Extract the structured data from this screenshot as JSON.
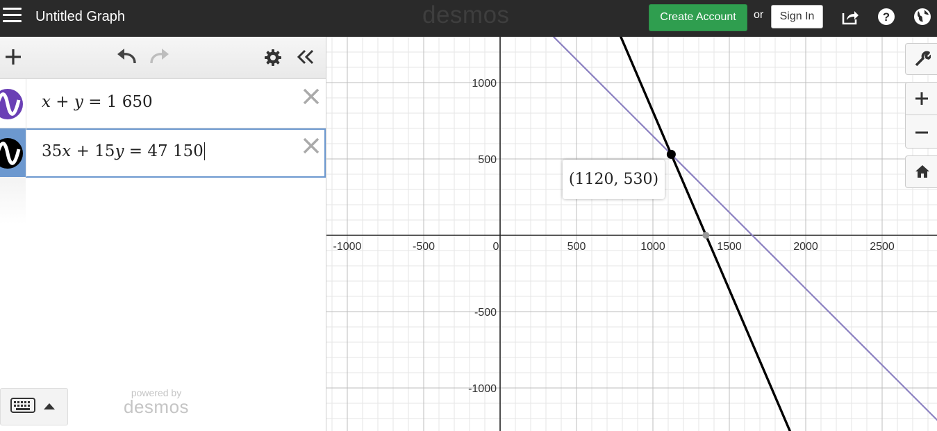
{
  "topbar": {
    "title": "Untitled Graph",
    "logo": "desmos",
    "create_account": "Create Account",
    "or": "or",
    "sign_in": "Sign In"
  },
  "expressions": [
    {
      "index": 1,
      "color": "#6a3fb5",
      "tokens": [
        "x",
        " + ",
        "y",
        " = 1 650"
      ]
    },
    {
      "index": 2,
      "color": "#000000",
      "tokens": [
        "35",
        "x",
        " + 15",
        "y",
        " = 47 150"
      ]
    }
  ],
  "footer": {
    "powered_by": "powered by",
    "brand": "desmos"
  },
  "graph": {
    "x_ticks": [
      "-1000",
      "-500",
      "0",
      "500",
      "1000",
      "1500",
      "2000",
      "2500"
    ],
    "y_ticks": [
      "1000",
      "500",
      "-500",
      "-1000"
    ],
    "intersection_label": "(1120, 530)",
    "intersection": [
      1120,
      530
    ],
    "x_intercept_line2": [
      1347,
      0
    ],
    "line_colors": {
      "line1": "#8a7fc0",
      "line2": "#000000"
    }
  }
}
